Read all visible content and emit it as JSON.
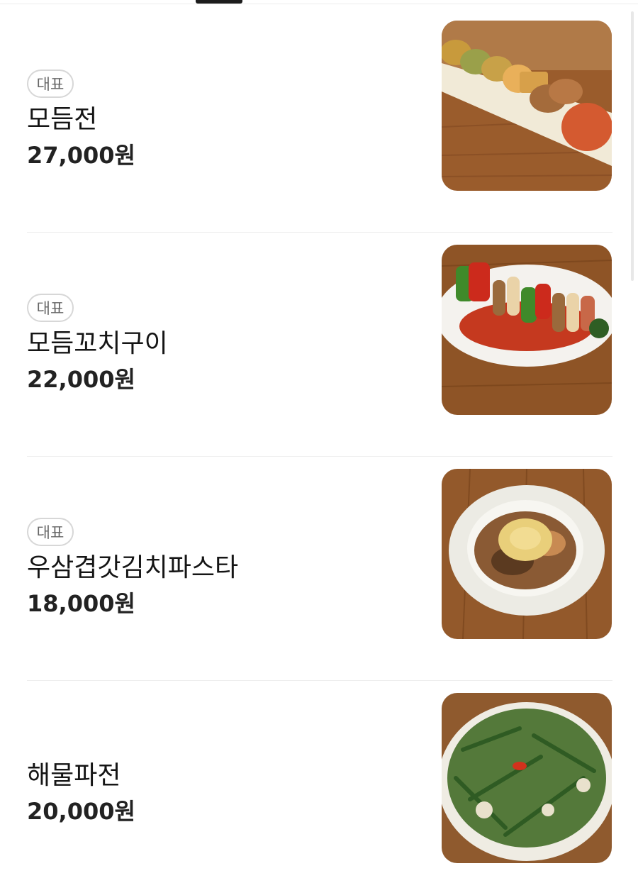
{
  "menu": {
    "items": [
      {
        "badge": "대표",
        "name": "모듬전",
        "price": "27,000원",
        "photo": "모듬전 사진"
      },
      {
        "badge": "대표",
        "name": "모듬꼬치구이",
        "price": "22,000원",
        "photo": "모듬꼬치구이 사진"
      },
      {
        "badge": "대표",
        "name": "우삼겹갓김치파스타",
        "price": "18,000원",
        "photo": "우삼겹갓김치파스타 사진"
      },
      {
        "name": "해물파전",
        "price": "20,000원",
        "photo": "해물파전 사진"
      }
    ]
  }
}
